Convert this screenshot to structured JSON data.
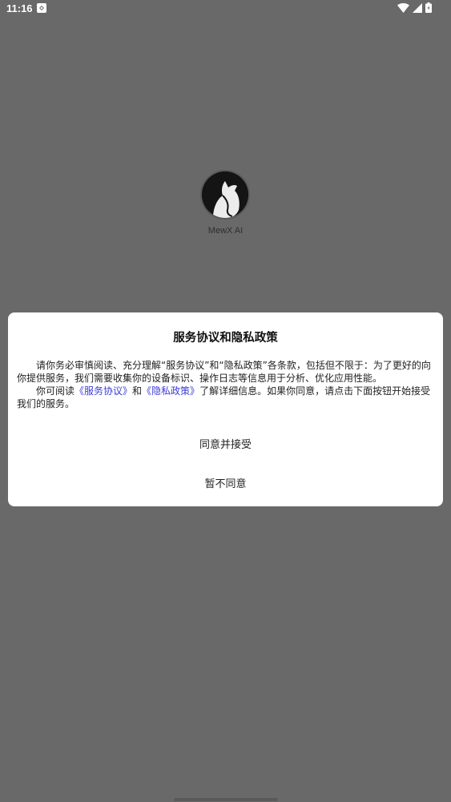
{
  "status_bar": {
    "time": "11:16",
    "app_icon": "app-notification-icon",
    "icons": [
      "wifi-icon",
      "cellular-signal-icon",
      "battery-icon"
    ]
  },
  "splash": {
    "app_name": "MewX AI",
    "logo_icon": "cat-logo-icon"
  },
  "dialog": {
    "title": "服务协议和隐私政策",
    "paragraph1": "请你务必审慎阅读、充分理解“服务协议”和“隐私政策”各条款，包括但不限于：为了更好的向你提供服务，我们需要收集你的设备标识、操作日志等信息用于分析、优化应用性能。",
    "paragraph2_prefix": "你可阅读",
    "link_terms": "《服务协议》",
    "paragraph2_and": "和",
    "link_privacy": "《隐私政策》",
    "paragraph2_suffix": "了解详细信息。如果你同意，请点击下面按钮开始接受我们的服务。",
    "accept_label": "同意并接受",
    "decline_label": "暂不同意"
  },
  "colors": {
    "scrim": "#696969",
    "dialog_bg": "#ffffff",
    "link": "#3c3cd8"
  }
}
